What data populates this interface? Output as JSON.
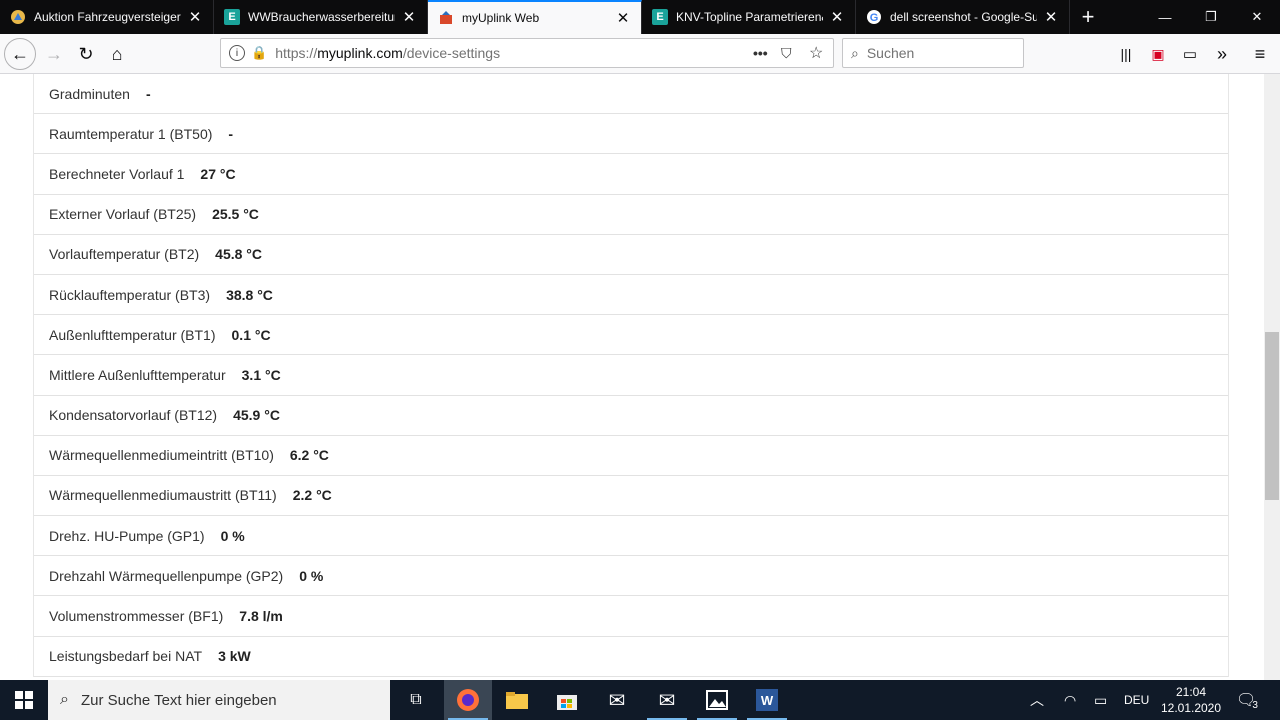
{
  "browser": {
    "tabs": [
      {
        "label": "Auktion Fahrzeugversteigerung",
        "icon": "auction-site-icon",
        "active": false
      },
      {
        "label": "WWBraucherwasserbereitung",
        "icon": "e-icon",
        "active": false
      },
      {
        "label": "myUplink Web",
        "icon": "myuplink-icon",
        "active": true
      },
      {
        "label": "KNV-Topline Parametrieren&",
        "icon": "e-icon",
        "active": false
      },
      {
        "label": "dell screenshot - Google-Suche",
        "icon": "google-icon",
        "active": false
      }
    ],
    "url_prefix": "https://",
    "url_host": "myuplink.com",
    "url_path": "/device-settings",
    "search_placeholder": "Suchen"
  },
  "parameters": [
    {
      "label": "Gradminuten",
      "value": "-"
    },
    {
      "label": "Raumtemperatur 1 (BT50)",
      "value": "-"
    },
    {
      "label": "Berechneter Vorlauf 1",
      "value": "27 °C"
    },
    {
      "label": "Externer Vorlauf (BT25)",
      "value": "25.5 °C"
    },
    {
      "label": "Vorlauftemperatur (BT2)",
      "value": "45.8 °C"
    },
    {
      "label": "Rücklauftemperatur (BT3)",
      "value": "38.8 °C"
    },
    {
      "label": "Außenlufttemperatur (BT1)",
      "value": "0.1 °C"
    },
    {
      "label": "Mittlere Außenlufttemperatur",
      "value": "3.1 °C"
    },
    {
      "label": "Kondensatorvorlauf (BT12)",
      "value": "45.9 °C"
    },
    {
      "label": "Wärmequellenmediumeintritt (BT10)",
      "value": "6.2 °C"
    },
    {
      "label": "Wärmequellenmediumaustritt (BT11)",
      "value": "2.2 °C"
    },
    {
      "label": "Drehz. HU-Pumpe (GP1)",
      "value": "0 %"
    },
    {
      "label": "Drehzahl Wärmequellenpumpe (GP2)",
      "value": "0 %"
    },
    {
      "label": "Volumenstrommesser (BF1)",
      "value": "7.8 l/m"
    },
    {
      "label": "Leistungsbedarf bei NAT",
      "value": "3 kW"
    }
  ],
  "taskbar": {
    "search_placeholder": "Zur Suche Text hier eingeben",
    "language": "DEU",
    "time": "21:04",
    "date": "12.01.2020",
    "notification_count": "3"
  }
}
